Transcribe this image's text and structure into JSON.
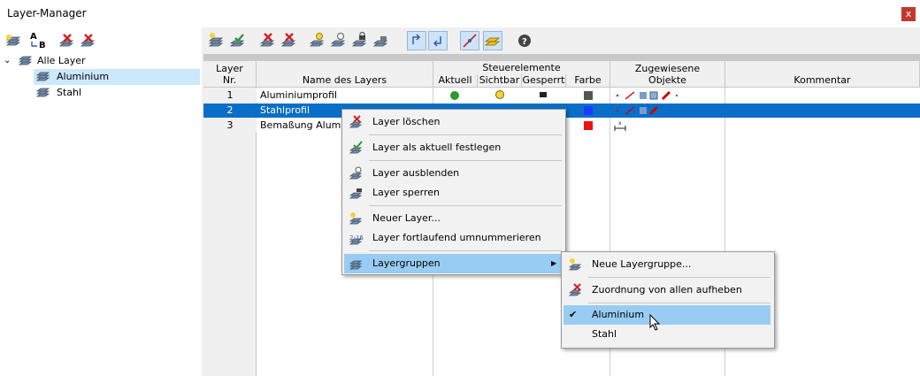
{
  "window": {
    "title": "Layer-Manager",
    "close": "x"
  },
  "tree": {
    "root": "Alle Layer",
    "items": [
      {
        "label": "Aluminium",
        "selected": true
      },
      {
        "label": "Stahl",
        "selected": false
      }
    ]
  },
  "left_toolbar": {
    "rename_label_a": "A",
    "rename_label_b": "B"
  },
  "grid": {
    "headers": {
      "nr": "Layer\nNr.",
      "nr_line1": "Layer",
      "nr_line2": "Nr.",
      "name": "Name des Layers",
      "controls_group": "Steuerelemente",
      "aktuell": "Aktuell",
      "sichtbar": "Sichtbar",
      "gesperrt": "Gesperrt",
      "farbe": "Farbe",
      "objects_line1": "Zugewiesene",
      "objects_line2": "Objekte",
      "kommentar": "Kommentar"
    },
    "rows": [
      {
        "nr": "1",
        "name": "Aluminiumprofil",
        "color": "#555555"
      },
      {
        "nr": "2",
        "name": "Stahlprofil",
        "color": "#1a3cff"
      },
      {
        "nr": "3",
        "name": "Bemaßung Alumin",
        "color": "#ee1111"
      }
    ]
  },
  "context_menu": {
    "items": [
      {
        "label": "Layer löschen",
        "icon": "delete-layer-icon"
      },
      {
        "label": "Layer als aktuell festlegen",
        "icon": "set-current-icon"
      },
      {
        "label": "Layer ausblenden",
        "icon": "hide-layer-icon"
      },
      {
        "label": "Layer sperren",
        "icon": "lock-layer-icon"
      },
      {
        "label": "Neuer Layer...",
        "icon": "new-layer-icon"
      },
      {
        "label": "Layer fortlaufend umnummerieren",
        "icon": "renumber-icon"
      },
      {
        "label": "Layergruppen",
        "icon": "layer-groups-icon"
      }
    ],
    "renumber_badge": "2-16"
  },
  "submenu": {
    "items": [
      {
        "label": "Neue Layergruppe...",
        "icon": "new-group-icon"
      },
      {
        "label": "Zuordnung von allen aufheben",
        "icon": "remove-assignment-icon"
      },
      {
        "label": "Aluminium",
        "checked": true
      },
      {
        "label": "Stahl",
        "checked": false
      }
    ],
    "check": "✔"
  },
  "colors": {
    "selection": "#0a6ec8",
    "menu_highlight": "#99ccf2",
    "tree_selection": "#cce8ff"
  }
}
